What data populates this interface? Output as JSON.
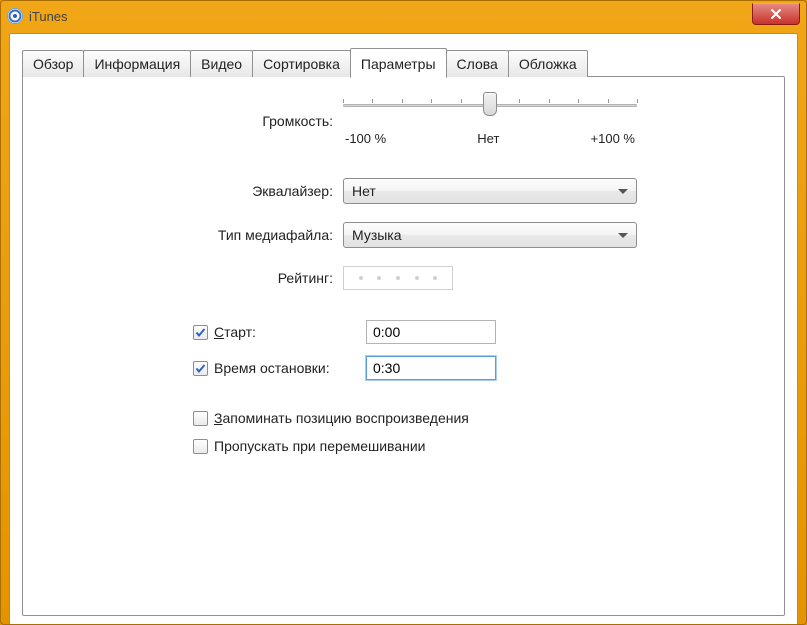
{
  "window": {
    "title": "iTunes"
  },
  "tabs": {
    "t0": "Обзор",
    "t1": "Информация",
    "t2": "Видео",
    "t3": "Сортировка",
    "t4": "Параметры",
    "t5": "Слова",
    "t6": "Обложка"
  },
  "labels": {
    "volume": "Громкость:",
    "equalizer": "Эквалайзер:",
    "media_type": "Тип медиафайла:",
    "rating": "Рейтинг:",
    "start": "Старт:",
    "stop": "Время остановки:",
    "remember_pos": "Запоминать позицию воспроизведения",
    "skip_shuffle": "Пропускать при перемешивании"
  },
  "values": {
    "equalizer": "Нет",
    "media_type": "Музыка",
    "start": "0:00",
    "stop": "0:30"
  },
  "slider": {
    "left": "-100 %",
    "center": "Нет",
    "right": "+100 %"
  },
  "checks": {
    "start": true,
    "stop": true,
    "remember_pos": false,
    "skip_shuffle": false
  }
}
